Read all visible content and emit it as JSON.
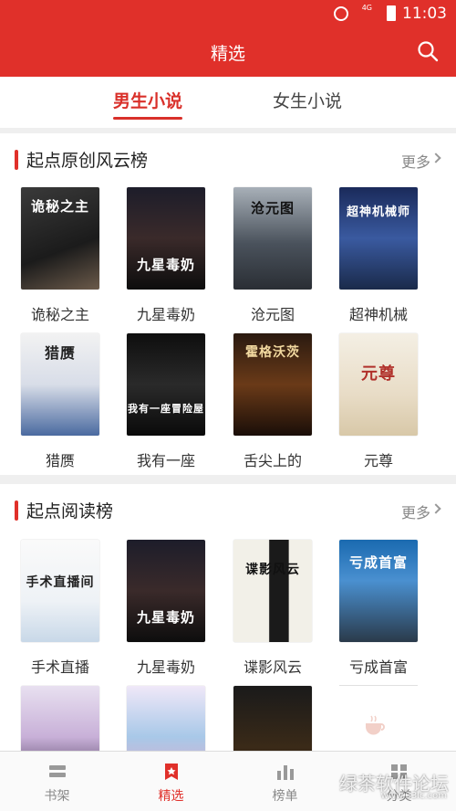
{
  "status_bar": {
    "time": "11:03",
    "network": "4G"
  },
  "header": {
    "title": "精选"
  },
  "tabs": [
    {
      "label": "男生小说",
      "active": true
    },
    {
      "label": "女生小说",
      "active": false
    }
  ],
  "sections": [
    {
      "title": "起点原创风云榜",
      "more": "更多",
      "books": [
        {
          "name": "诡秘之主",
          "cover_text": "诡秘之主"
        },
        {
          "name": "九星毒奶",
          "cover_text": "九星毒奶"
        },
        {
          "name": "沧元图",
          "cover_text": "沧元图"
        },
        {
          "name": "超神机械",
          "cover_text": "超神机械师"
        },
        {
          "name": "猎赝",
          "cover_text": "猎赝"
        },
        {
          "name": "我有一座",
          "cover_text": "我有一座冒险屋"
        },
        {
          "name": "舌尖上的",
          "cover_text": "霍格沃茨"
        },
        {
          "name": "元尊",
          "cover_text": "元尊"
        }
      ]
    },
    {
      "title": "起点阅读榜",
      "more": "更多",
      "books": [
        {
          "name": "手术直播",
          "cover_text": "手术直播间"
        },
        {
          "name": "九星毒奶",
          "cover_text": "九星毒奶"
        },
        {
          "name": "谍影风云",
          "cover_text": "谍影风云"
        },
        {
          "name": "亏成首富",
          "cover_text": "亏成首富"
        }
      ]
    }
  ],
  "bottom_nav": [
    {
      "label": "书架",
      "icon": "bookshelf-icon",
      "active": false
    },
    {
      "label": "精选",
      "icon": "featured-icon",
      "active": true
    },
    {
      "label": "榜单",
      "icon": "ranking-icon",
      "active": false
    },
    {
      "label": "分类",
      "icon": "category-icon",
      "active": false
    }
  ],
  "watermark": {
    "line1": "绿茶软件论坛",
    "line2": "www.33lc.com"
  },
  "colors": {
    "brand": "#e0302a",
    "active_text": "#d9302a"
  }
}
